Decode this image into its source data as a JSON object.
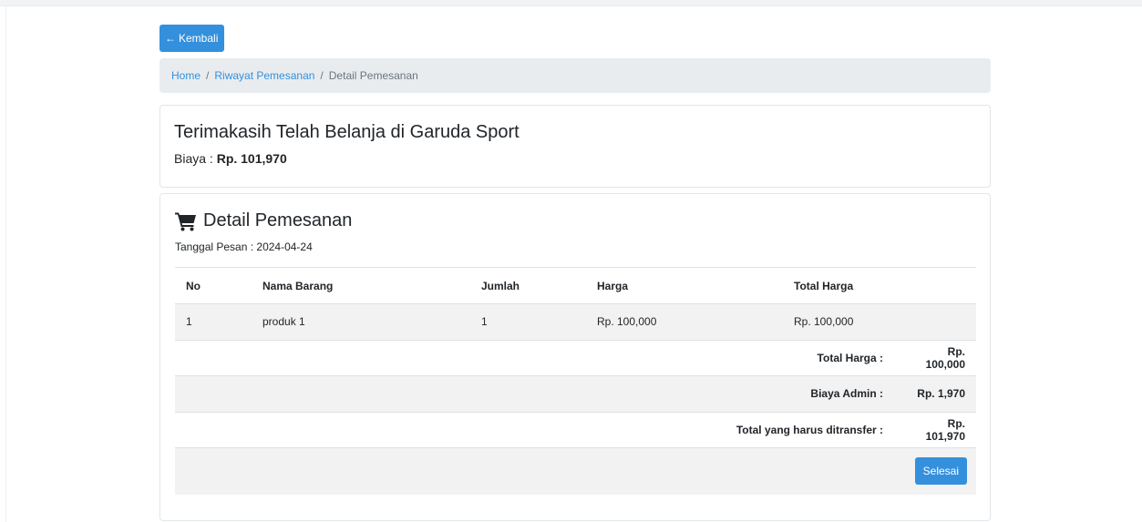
{
  "nav": {
    "back_label": "Kembali"
  },
  "breadcrumb": {
    "home": "Home",
    "history": "Riwayat Pemesanan",
    "current": "Detail Pemesanan",
    "separator": "/"
  },
  "thanks": {
    "title": "Terimakasih Telah Belanja di Garuda Sport",
    "cost_label": "Biaya :",
    "cost_value": "Rp. 101,970"
  },
  "order": {
    "title": "Detail Pemesanan",
    "date_label": "Tanggal Pesan : 2024-04-24",
    "columns": [
      "No",
      "Nama Barang",
      "Jumlah",
      "Harga",
      "Total Harga"
    ],
    "items": [
      {
        "no": "1",
        "name": "produk 1",
        "qty": "1",
        "price": "Rp. 100,000",
        "total": "Rp. 100,000"
      }
    ],
    "summary": {
      "total_label": "Total Harga :",
      "total_value": "Rp. 100,000",
      "admin_label": "Biaya Admin :",
      "admin_value": "Rp. 1,970",
      "transfer_label": "Total yang harus ditransfer :",
      "transfer_value": "Rp. 101,970"
    },
    "done_label": "Selesai"
  },
  "colors": {
    "primary": "#3490dc",
    "breadcrumb_bg": "#e9ecef",
    "stripe": "#f2f2f2"
  }
}
